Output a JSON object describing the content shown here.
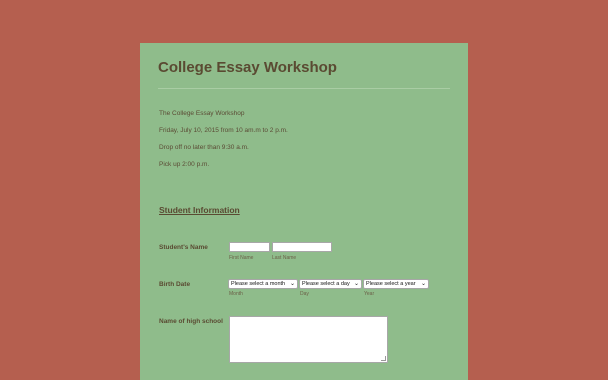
{
  "form": {
    "title": "College Essay Workshop",
    "info_lines": [
      "The College Essay Workshop",
      "Friday, July 10, 2015 from 10 am.m to 2 p.m.",
      "Drop off no later than 9:30 a.m.",
      "Pick up 2:00 p.m."
    ],
    "section_title": "Student Information",
    "student_name": {
      "label": "Student's Name",
      "first_value": "",
      "first_sublabel": "First Name",
      "last_value": "",
      "last_sublabel": "Last Name"
    },
    "birth_date": {
      "label": "Birth Date",
      "month_selected": "Please select a month",
      "month_sublabel": "Month",
      "day_selected": "Please select a day",
      "day_sublabel": "Day",
      "year_selected": "Please select a year",
      "year_sublabel": "Year"
    },
    "high_school": {
      "label": "Name of high school",
      "value": ""
    }
  },
  "colors": {
    "background": "#b55f4f",
    "card": "#8fbc8b",
    "text": "#5a4a32"
  }
}
